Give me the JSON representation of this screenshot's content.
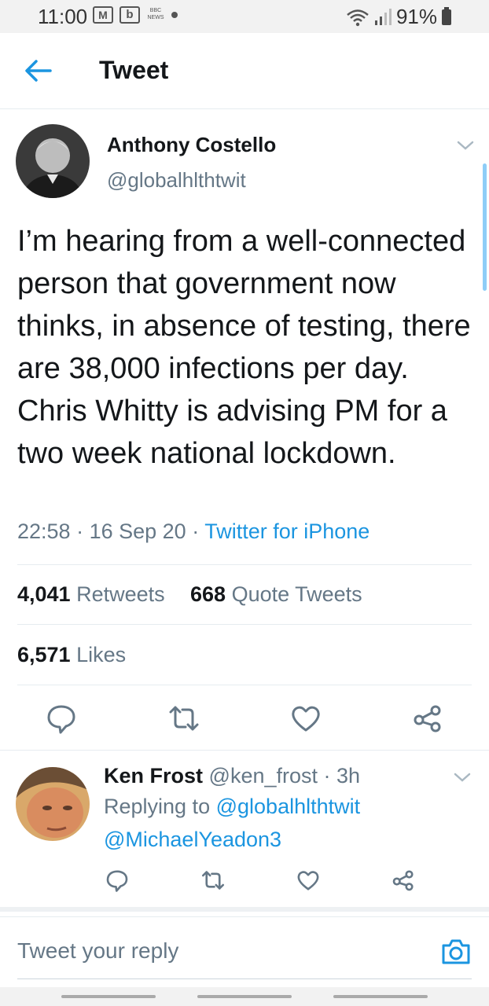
{
  "status": {
    "time": "11:00",
    "icon_b": "b",
    "news": "BBC NEWS",
    "battery": "91%"
  },
  "header": {
    "title": "Tweet"
  },
  "tweet": {
    "name": "Anthony Costello",
    "handle": "@globalhlthtwit",
    "text": "I’m hearing from a well-connected person that government now thinks, in absence of testing, there are 38,000 infections per day. Chris Whitty is advising PM for a two week national lockdown.",
    "time": "22:58",
    "date": "16 Sep 20",
    "source": "Twitter for iPhone",
    "retweets_count": "4,041",
    "retweets_label": "Retweets",
    "quotes_count": "668",
    "quotes_label": "Quote Tweets",
    "likes_count": "6,571",
    "likes_label": "Likes"
  },
  "reply_tweet": {
    "name": "Ken Frost",
    "handle": "@ken_frost",
    "age": "3h",
    "replying_prefix": "Replying to",
    "replying_to_1": "@globalhlthtwit",
    "replying_to_2": "@MichaelYeadon3"
  },
  "composer": {
    "placeholder": "Tweet your reply"
  },
  "colors": {
    "accent": "#1b95e0",
    "muted": "#657786",
    "text": "#14171a"
  },
  "icons": [
    "back-arrow-icon",
    "chevron-down-icon",
    "reply-icon",
    "retweet-icon",
    "like-icon",
    "share-icon",
    "camera-icon"
  ]
}
